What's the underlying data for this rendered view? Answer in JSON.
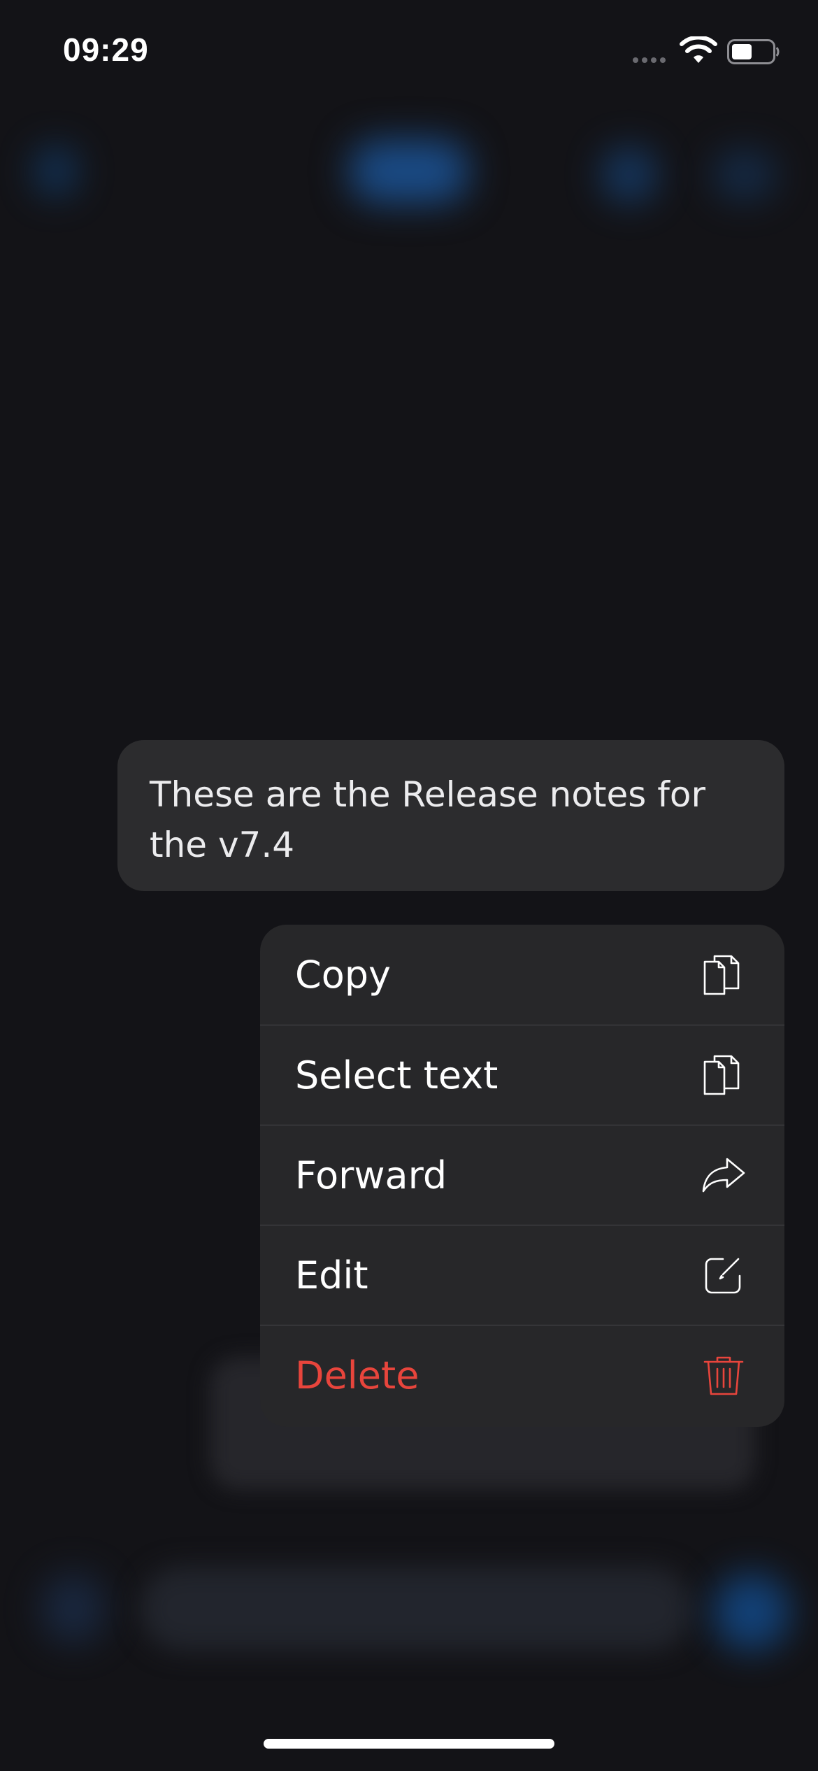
{
  "status_bar": {
    "time": "09:29",
    "wifi_icon": "wifi-icon",
    "battery_icon": "battery-half-icon"
  },
  "message": {
    "text": "These are the Release notes for the v7.4"
  },
  "context_menu": {
    "items": [
      {
        "label": "Copy",
        "icon": "copy-icon",
        "color": "#ffffff"
      },
      {
        "label": "Select text",
        "icon": "select-text-icon",
        "color": "#ffffff"
      },
      {
        "label": "Forward",
        "icon": "forward-arrow-icon",
        "color": "#ffffff"
      },
      {
        "label": "Edit",
        "icon": "edit-icon",
        "color": "#ffffff"
      },
      {
        "label": "Delete",
        "icon": "trash-icon",
        "color": "#e8453c"
      }
    ]
  },
  "colors": {
    "background": "#131317",
    "bubble": "#2c2c2e",
    "menu": "#272729",
    "danger": "#e8453c"
  }
}
